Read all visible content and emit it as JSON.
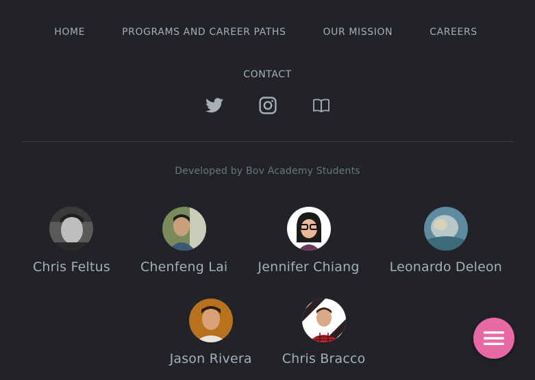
{
  "nav": {
    "items": [
      {
        "label": "HOME"
      },
      {
        "label": "PROGRAMS AND CAREER PATHS"
      },
      {
        "label": "OUR MISSION"
      },
      {
        "label": "CAREERS"
      },
      {
        "label": "CONTACT"
      }
    ]
  },
  "social": {
    "icons": [
      "twitter-icon",
      "instagram-icon",
      "book-icon"
    ]
  },
  "credit": "Developed by Bov Academy Students",
  "people": [
    {
      "name": "Chris Feltus"
    },
    {
      "name": "Chenfeng Lai"
    },
    {
      "name": "Jennifer Chiang"
    },
    {
      "name": "Leonardo Deleon"
    },
    {
      "name": "Jason Rivera"
    },
    {
      "name": "Chris Bracco"
    }
  ],
  "fab": {
    "icon": "menu-icon"
  },
  "colors": {
    "background": "#212329",
    "nav_text": "#a9aeb8",
    "muted_text": "#6f747d",
    "accent": "#e76aa7"
  }
}
